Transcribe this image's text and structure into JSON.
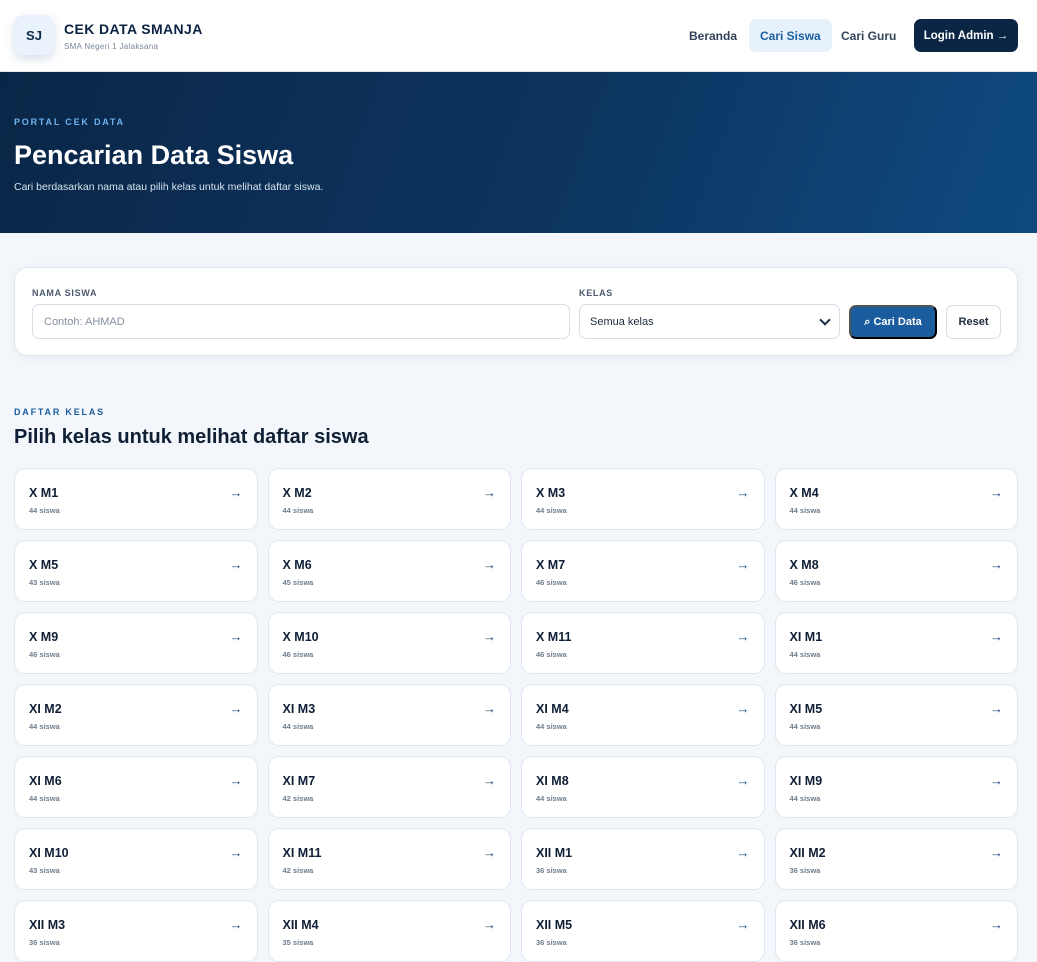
{
  "header": {
    "logo_text": "SJ",
    "brand_title": "CEK DATA SMANJA",
    "brand_subtitle": "SMA Negeri 1 Jalaksana",
    "nav": [
      "Beranda",
      "Cari Siswa",
      "Cari Guru"
    ],
    "login_label": "Login Admin →"
  },
  "hero": {
    "kicker": "PORTAL CEK DATA",
    "title": "Pencarian Data Siswa",
    "description": "Cari berdasarkan nama atau pilih kelas untuk melihat daftar siswa."
  },
  "search": {
    "name_label": "NAMA SISWA",
    "name_placeholder": "Contoh: AHMAD",
    "name_value": "",
    "class_label": "KELAS",
    "class_selected": "Semua kelas",
    "search_button": "⌕ Cari Data",
    "reset_button": "Reset"
  },
  "section": {
    "kicker": "DAFTAR KELAS",
    "title": "Pilih kelas untuk melihat daftar siswa"
  },
  "classes": [
    {
      "name": "X M1",
      "count": "44 siswa"
    },
    {
      "name": "X M2",
      "count": "44 siswa"
    },
    {
      "name": "X M3",
      "count": "44 siswa"
    },
    {
      "name": "X M4",
      "count": "44 siswa"
    },
    {
      "name": "X M5",
      "count": "43 siswa"
    },
    {
      "name": "X M6",
      "count": "45 siswa"
    },
    {
      "name": "X M7",
      "count": "46 siswa"
    },
    {
      "name": "X M8",
      "count": "46 siswa"
    },
    {
      "name": "X M9",
      "count": "46 siswa"
    },
    {
      "name": "X M10",
      "count": "46 siswa"
    },
    {
      "name": "X M11",
      "count": "46 siswa"
    },
    {
      "name": "XI M1",
      "count": "44 siswa"
    },
    {
      "name": "XI M2",
      "count": "44 siswa"
    },
    {
      "name": "XI M3",
      "count": "44 siswa"
    },
    {
      "name": "XI M4",
      "count": "44 siswa"
    },
    {
      "name": "XI M5",
      "count": "44 siswa"
    },
    {
      "name": "XI M6",
      "count": "44 siswa"
    },
    {
      "name": "XI M7",
      "count": "42 siswa"
    },
    {
      "name": "XI M8",
      "count": "44 siswa"
    },
    {
      "name": "XI M9",
      "count": "44 siswa"
    },
    {
      "name": "XI M10",
      "count": "43 siswa"
    },
    {
      "name": "XI M11",
      "count": "42 siswa"
    },
    {
      "name": "XII M1",
      "count": "36 siswa"
    },
    {
      "name": "XII M2",
      "count": "36 siswa"
    },
    {
      "name": "XII M3",
      "count": "36 siswa"
    },
    {
      "name": "XII M4",
      "count": "35 siswa"
    },
    {
      "name": "XII M5",
      "count": "36 siswa"
    },
    {
      "name": "XII M6",
      "count": "36 siswa"
    }
  ],
  "card_arrow": "→",
  "colors": {
    "primary": "#1b5c9e",
    "navy": "#0b2545",
    "hero_start": "#0a2647",
    "hero_end": "#0e4a80"
  }
}
